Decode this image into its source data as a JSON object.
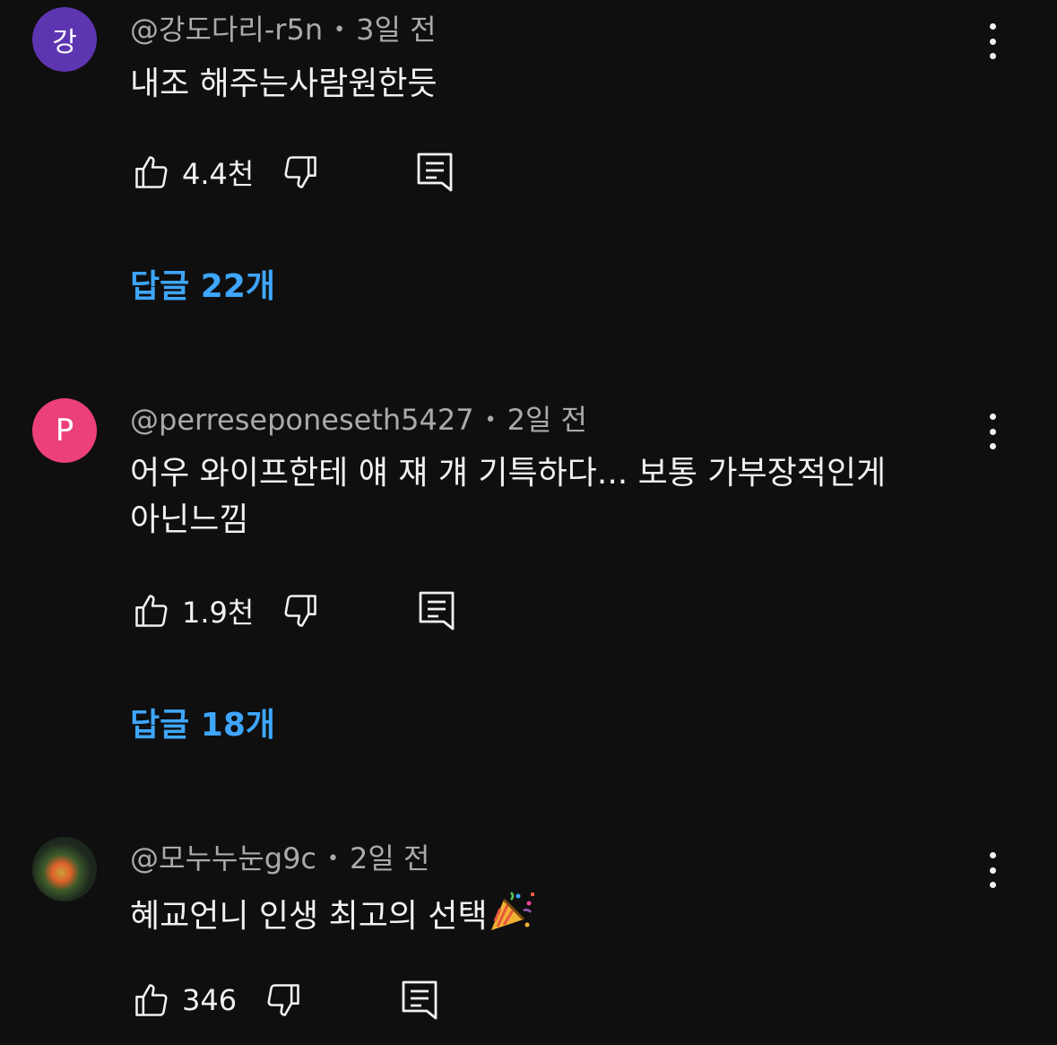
{
  "colors": {
    "background": "#0f0f0f",
    "link": "#3ea6ff",
    "meta": "#aaaaaa"
  },
  "comments": [
    {
      "avatar_letter": "강",
      "avatar_color": "#5e35b1",
      "author": "@강도다리-r5n",
      "time": "3일 전",
      "text": "내조 해주는사람원한듯",
      "likes": "4.4천",
      "replies": "답글 22개"
    },
    {
      "avatar_letter": "P",
      "avatar_color": "#ec407a",
      "author": "@perreseponeseth5427",
      "time": "2일 전",
      "text": "어우 와이프한테 얘 쟤 걔 기특하다... 보통 가부장적인게 아닌느낌",
      "likes": "1.9천",
      "replies": "답글 18개"
    },
    {
      "avatar_letter": "",
      "author": "@모누누눈g9c",
      "time": "2일 전",
      "text": "혜교언니 인생 최고의 선택",
      "text_emoji": "party-popper-emoji",
      "likes": "346"
    }
  ],
  "icons": {
    "like": "thumbs-up-icon",
    "dislike": "thumbs-down-icon",
    "reply": "comment-reply-icon",
    "more": "more-vertical-icon"
  }
}
